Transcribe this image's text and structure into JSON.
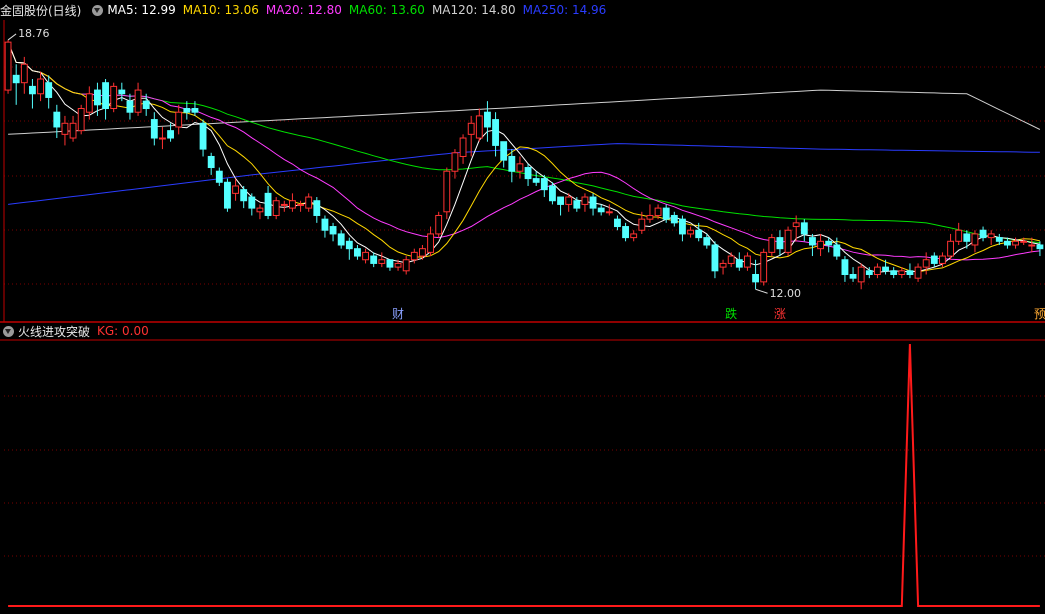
{
  "stock_title": "金固股份(日线)",
  "ma_legend": [
    {
      "label": "MA5: 12.99",
      "color": "#ffffff"
    },
    {
      "label": "MA10: 13.06",
      "color": "#ffd800"
    },
    {
      "label": "MA20: 12.80",
      "color": "#ff3cff"
    },
    {
      "label": "MA60: 13.60",
      "color": "#00e000"
    },
    {
      "label": "MA120: 14.80",
      "color": "#cfcfcf"
    },
    {
      "label": "MA250: 14.96",
      "color": "#2a3cff"
    }
  ],
  "indicator_title": "火线进攻突破",
  "indicator_value": "KG: 0.00",
  "colors": {
    "up": "#ff3232",
    "down": "#54ffff",
    "ma5": "#ffffff",
    "ma10": "#ffd800",
    "ma20": "#ff3cff",
    "ma60": "#00e000",
    "ma120": "#cfcfcf",
    "ma250": "#2a3cff",
    "grid": "#7a0000",
    "separator": "#c00000",
    "kg": "#ff1a1a"
  },
  "chart_data": {
    "type": "candlestick",
    "ylim": [
      11.6,
      19.3
    ],
    "high_marker": "18.76",
    "low_marker": "12.00",
    "candles": [
      [
        17.4,
        18.7,
        17.3,
        18.76
      ],
      [
        17.8,
        17.6,
        17.0,
        18.1
      ],
      [
        17.6,
        18.1,
        17.3,
        18.3
      ],
      [
        17.5,
        17.3,
        16.9,
        17.7
      ],
      [
        17.3,
        17.7,
        17.1,
        17.9
      ],
      [
        17.6,
        17.2,
        16.9,
        17.8
      ],
      [
        16.8,
        16.4,
        16.1,
        17.0
      ],
      [
        16.2,
        16.5,
        15.9,
        16.7
      ],
      [
        16.1,
        16.5,
        16.0,
        16.7
      ],
      [
        16.3,
        16.9,
        16.2,
        17.0
      ],
      [
        16.8,
        17.3,
        16.6,
        17.5
      ],
      [
        17.4,
        17.0,
        16.7,
        17.6
      ],
      [
        17.6,
        16.9,
        16.6,
        17.7
      ],
      [
        16.9,
        17.5,
        16.8,
        17.6
      ],
      [
        17.4,
        17.3,
        17.1,
        17.6
      ],
      [
        17.1,
        16.8,
        16.6,
        17.3
      ],
      [
        16.8,
        17.4,
        16.7,
        17.6
      ],
      [
        17.1,
        16.9,
        16.7,
        17.3
      ],
      [
        16.6,
        16.1,
        15.9,
        16.8
      ],
      [
        16.1,
        16.1,
        15.8,
        16.4
      ],
      [
        16.3,
        16.1,
        16.0,
        16.5
      ],
      [
        16.4,
        16.8,
        16.2,
        17.0
      ],
      [
        16.9,
        16.8,
        16.6,
        17.1
      ],
      [
        16.9,
        16.8,
        16.7,
        17.1
      ],
      [
        16.5,
        15.8,
        15.6,
        16.6
      ],
      [
        15.6,
        15.3,
        15.1,
        15.7
      ],
      [
        15.2,
        14.9,
        14.8,
        15.3
      ],
      [
        14.9,
        14.2,
        14.1,
        15.0
      ],
      [
        14.6,
        14.8,
        14.4,
        15.0
      ],
      [
        14.7,
        14.4,
        14.2,
        14.8
      ],
      [
        14.5,
        14.2,
        14.0,
        14.6
      ],
      [
        14.1,
        14.2,
        13.9,
        14.3
      ],
      [
        14.6,
        14.0,
        13.9,
        14.8
      ],
      [
        14.0,
        14.4,
        13.9,
        14.5
      ],
      [
        14.3,
        14.3,
        14.1,
        14.4
      ],
      [
        14.2,
        14.4,
        14.1,
        14.6
      ],
      [
        14.3,
        14.3,
        14.1,
        14.4
      ],
      [
        14.2,
        14.5,
        14.1,
        14.6
      ],
      [
        14.4,
        14.0,
        13.8,
        14.5
      ],
      [
        13.9,
        13.6,
        13.4,
        14.0
      ],
      [
        13.7,
        13.5,
        13.3,
        13.8
      ],
      [
        13.5,
        13.2,
        13.1,
        13.6
      ],
      [
        13.3,
        13.1,
        12.8,
        13.4
      ],
      [
        13.1,
        12.9,
        12.8,
        13.2
      ],
      [
        12.8,
        13.0,
        12.7,
        13.1
      ],
      [
        12.9,
        12.7,
        12.6,
        13.0
      ],
      [
        12.7,
        12.8,
        12.6,
        13.0
      ],
      [
        12.8,
        12.6,
        12.5,
        12.8
      ],
      [
        12.6,
        12.7,
        12.5,
        12.8
      ],
      [
        12.5,
        12.8,
        12.4,
        12.9
      ],
      [
        12.8,
        13.0,
        12.7,
        13.1
      ],
      [
        12.9,
        13.1,
        12.8,
        13.2
      ],
      [
        13.0,
        13.5,
        12.9,
        13.7
      ],
      [
        13.5,
        14.0,
        13.4,
        14.1
      ],
      [
        14.1,
        15.2,
        13.9,
        15.3
      ],
      [
        15.2,
        15.7,
        15.0,
        15.8
      ],
      [
        15.6,
        16.1,
        15.4,
        16.2
      ],
      [
        16.2,
        16.5,
        15.6,
        16.7
      ],
      [
        16.1,
        16.7,
        16.0,
        16.9
      ],
      [
        16.8,
        16.4,
        16.0,
        17.1
      ],
      [
        16.6,
        15.9,
        15.6,
        16.8
      ],
      [
        16.0,
        15.5,
        15.3,
        16.0
      ],
      [
        15.6,
        15.2,
        14.9,
        15.8
      ],
      [
        15.2,
        15.4,
        15.0,
        15.6
      ],
      [
        15.3,
        15.0,
        14.8,
        15.4
      ],
      [
        15.0,
        14.9,
        14.8,
        15.2
      ],
      [
        15.0,
        14.7,
        14.5,
        15.1
      ],
      [
        14.8,
        14.4,
        14.3,
        14.9
      ],
      [
        14.5,
        14.3,
        14.0,
        14.5
      ],
      [
        14.3,
        14.5,
        14.1,
        14.6
      ],
      [
        14.4,
        14.2,
        14.1,
        14.5
      ],
      [
        14.3,
        14.5,
        14.1,
        14.6
      ],
      [
        14.5,
        14.2,
        14.0,
        14.6
      ],
      [
        14.2,
        14.1,
        14.0,
        14.3
      ],
      [
        14.1,
        14.1,
        14.0,
        14.3
      ],
      [
        13.9,
        13.7,
        13.6,
        14.0
      ],
      [
        13.7,
        13.4,
        13.3,
        13.8
      ],
      [
        13.4,
        13.5,
        13.3,
        13.6
      ],
      [
        13.6,
        13.9,
        13.5,
        14.1
      ],
      [
        13.9,
        14.0,
        13.8,
        14.3
      ],
      [
        14.0,
        14.2,
        13.9,
        14.3
      ],
      [
        14.2,
        13.9,
        13.8,
        14.3
      ],
      [
        14.0,
        13.8,
        13.7,
        14.1
      ],
      [
        13.9,
        13.5,
        13.3,
        14.0
      ],
      [
        13.5,
        13.6,
        13.4,
        13.7
      ],
      [
        13.6,
        13.4,
        13.3,
        13.8
      ],
      [
        13.4,
        13.2,
        13.1,
        13.5
      ],
      [
        13.2,
        12.5,
        12.3,
        13.3
      ],
      [
        12.6,
        12.7,
        12.4,
        12.8
      ],
      [
        12.7,
        12.9,
        12.6,
        13.0
      ],
      [
        12.8,
        12.6,
        12.5,
        13.0
      ],
      [
        12.6,
        12.9,
        12.5,
        13.0
      ],
      [
        12.4,
        12.2,
        12.0,
        12.8
      ],
      [
        12.2,
        13.0,
        12.1,
        13.1
      ],
      [
        13.0,
        13.4,
        12.9,
        13.5
      ],
      [
        13.4,
        13.1,
        12.9,
        13.6
      ],
      [
        13.0,
        13.6,
        12.9,
        13.7
      ],
      [
        13.7,
        13.8,
        13.3,
        14.0
      ],
      [
        13.8,
        13.5,
        13.3,
        13.9
      ],
      [
        13.4,
        13.2,
        12.9,
        13.5
      ],
      [
        13.1,
        13.3,
        12.9,
        13.5
      ],
      [
        13.3,
        13.2,
        13.0,
        13.4
      ],
      [
        13.2,
        12.9,
        12.8,
        13.4
      ],
      [
        12.8,
        12.4,
        12.2,
        12.9
      ],
      [
        12.4,
        12.3,
        12.2,
        12.6
      ],
      [
        12.2,
        12.6,
        12.0,
        12.7
      ],
      [
        12.5,
        12.4,
        12.3,
        12.6
      ],
      [
        12.4,
        12.6,
        12.3,
        12.7
      ],
      [
        12.6,
        12.5,
        12.4,
        12.8
      ],
      [
        12.5,
        12.4,
        12.3,
        12.6
      ],
      [
        12.4,
        12.5,
        12.3,
        12.6
      ],
      [
        12.5,
        12.4,
        12.3,
        12.7
      ],
      [
        12.3,
        12.6,
        12.2,
        12.7
      ],
      [
        12.6,
        12.8,
        12.4,
        13.0
      ],
      [
        12.9,
        12.7,
        12.6,
        13.0
      ],
      [
        12.7,
        12.9,
        12.6,
        13.0
      ],
      [
        12.9,
        13.3,
        12.8,
        13.5
      ],
      [
        13.3,
        13.6,
        13.2,
        13.8
      ],
      [
        13.5,
        13.3,
        13.1,
        13.6
      ],
      [
        13.2,
        13.5,
        13.0,
        13.6
      ],
      [
        13.6,
        13.4,
        13.3,
        13.7
      ],
      [
        13.4,
        13.5,
        13.2,
        13.6
      ],
      [
        13.4,
        13.3,
        13.2,
        13.5
      ],
      [
        13.3,
        13.2,
        13.1,
        13.4
      ],
      [
        13.2,
        13.3,
        13.1,
        13.4
      ],
      [
        13.3,
        13.3,
        13.2,
        13.4
      ],
      [
        13.2,
        13.2,
        13.0,
        13.4
      ],
      [
        13.2,
        13.1,
        12.9,
        13.3
      ]
    ],
    "ma120": [
      [
        0,
        16.2
      ],
      [
        60,
        16.9
      ],
      [
        100,
        17.4
      ],
      [
        118,
        17.3
      ],
      [
        131,
        15.9
      ],
      [
        137,
        15.5
      ]
    ],
    "ma250": [
      [
        0,
        14.3
      ],
      [
        30,
        15.1
      ],
      [
        55,
        15.7
      ],
      [
        75,
        15.95
      ],
      [
        100,
        15.8
      ],
      [
        131,
        15.7
      ],
      [
        137,
        15.6
      ]
    ],
    "event_labels": [
      {
        "index": 48,
        "text": "财",
        "color": "#8aa0ff"
      },
      {
        "index": 89,
        "text": "跌",
        "color": "#00e000"
      },
      {
        "index": 95,
        "text": "涨",
        "color": "#ff3232"
      },
      {
        "index": 127,
        "text": "预",
        "color": "#ffaa33"
      }
    ],
    "indicator": {
      "name": "KG",
      "ylim": [
        0,
        1
      ],
      "values_nonzero": [
        {
          "index": 111,
          "value": 1
        }
      ]
    }
  }
}
